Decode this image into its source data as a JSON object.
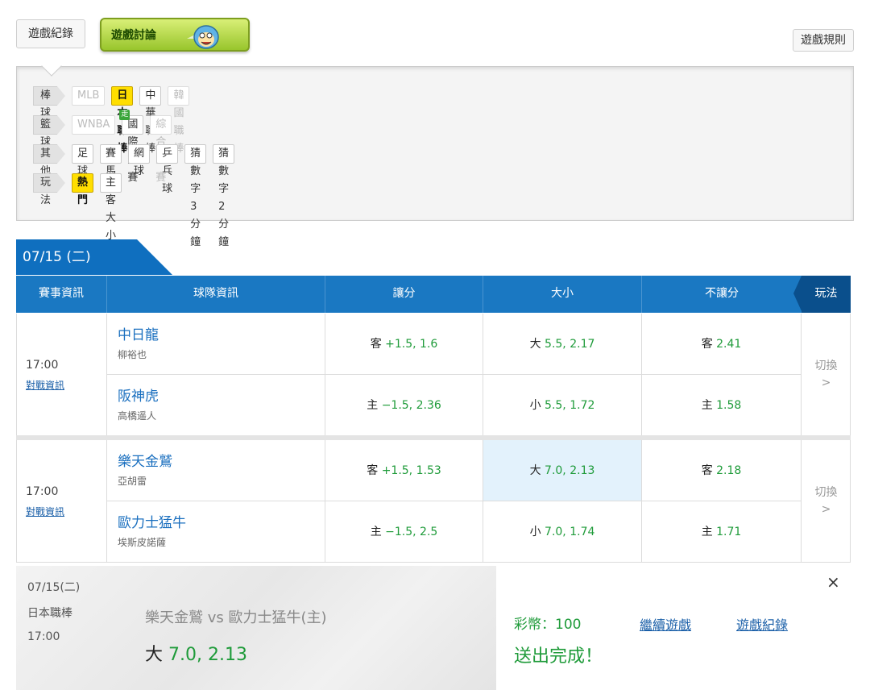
{
  "topbar": {
    "game_record": "遊戲紀錄",
    "game_discussion": "遊戲討論",
    "game_rules": "遊戲規則"
  },
  "filters": [
    {
      "category": "棒球",
      "chips": [
        {
          "label": "MLB",
          "state": "dim"
        },
        {
          "label": "日本職棒",
          "state": "active"
        },
        {
          "label": "中華職棒",
          "state": "normal"
        },
        {
          "label": "韓國職棒",
          "state": "dim"
        }
      ]
    },
    {
      "category": "籃球",
      "chips": [
        {
          "label": "WNBA",
          "state": "dim"
        },
        {
          "label": "國際籃賽",
          "state": "normal",
          "badge": "走"
        },
        {
          "label": "綜合籃賽",
          "state": "dim"
        }
      ]
    },
    {
      "category": "其他",
      "chips": [
        {
          "label": "足球",
          "state": "normal"
        },
        {
          "label": "賽馬",
          "state": "normal"
        },
        {
          "label": "網球",
          "state": "normal"
        },
        {
          "label": "乒乓球",
          "state": "normal"
        },
        {
          "label": "猜數字3分鐘",
          "state": "normal"
        },
        {
          "label": "猜數字2分鐘",
          "state": "normal"
        }
      ]
    },
    {
      "category": "玩法",
      "chips": [
        {
          "label": "熱門",
          "state": "active"
        },
        {
          "label": "主客大小",
          "state": "normal"
        }
      ]
    }
  ],
  "date_tab": "07/15 (二)",
  "table_headers": {
    "info": "賽事資訊",
    "teams": "球隊資訊",
    "spread": "讓分",
    "total": "大小",
    "moneyline": "不讓分",
    "play": "玩法"
  },
  "matches": [
    {
      "time": "17:00",
      "link": "對戰資訊",
      "switch": "切換",
      "switch_arrow": ">",
      "away": {
        "team": "中日龍",
        "pitcher": "柳裕也",
        "spread_side": "客",
        "spread_val": "+1.5, 1.6",
        "total_side": "大",
        "total_val": "5.5, 2.17",
        "ml_side": "客",
        "ml_val": "2.41"
      },
      "home": {
        "team": "阪神虎",
        "pitcher": "高橋遥人",
        "spread_side": "主",
        "spread_val": "−1.5, 2.36",
        "total_side": "小",
        "total_val": "5.5, 1.72",
        "ml_side": "主",
        "ml_val": "1.58"
      }
    },
    {
      "time": "17:00",
      "link": "對戰資訊",
      "switch": "切換",
      "switch_arrow": ">",
      "away": {
        "team": "樂天金鷲",
        "pitcher": "亞胡雷",
        "spread_side": "客",
        "spread_val": "+1.5, 1.53",
        "total_side": "大",
        "total_val": "7.0, 2.13",
        "ml_side": "客",
        "ml_val": "2.18"
      },
      "home": {
        "team": "歐力士猛牛",
        "pitcher": "埃斯皮諾薩",
        "spread_side": "主",
        "spread_val": "−1.5, 2.5",
        "total_side": "小",
        "total_val": "7.0, 1.74",
        "ml_side": "主",
        "ml_val": "1.71"
      }
    }
  ],
  "confirmation": {
    "date": "07/15(二)",
    "league": "日本職棒",
    "time": "17:00",
    "matchup": "樂天金鷲 vs 歐力士猛牛(主)",
    "bet_side": "大",
    "bet_value": "7.0, 2.13",
    "coins": "彩幣：100",
    "status": "送出完成！",
    "continue": "繼續遊戲",
    "record": "遊戲紀錄",
    "close": "×"
  },
  "colors": {
    "header_blue": "#1a78c2",
    "odds_green": "#1f9b3a",
    "highlight": "#e3f2fc",
    "active_chip": "#ffde00"
  }
}
